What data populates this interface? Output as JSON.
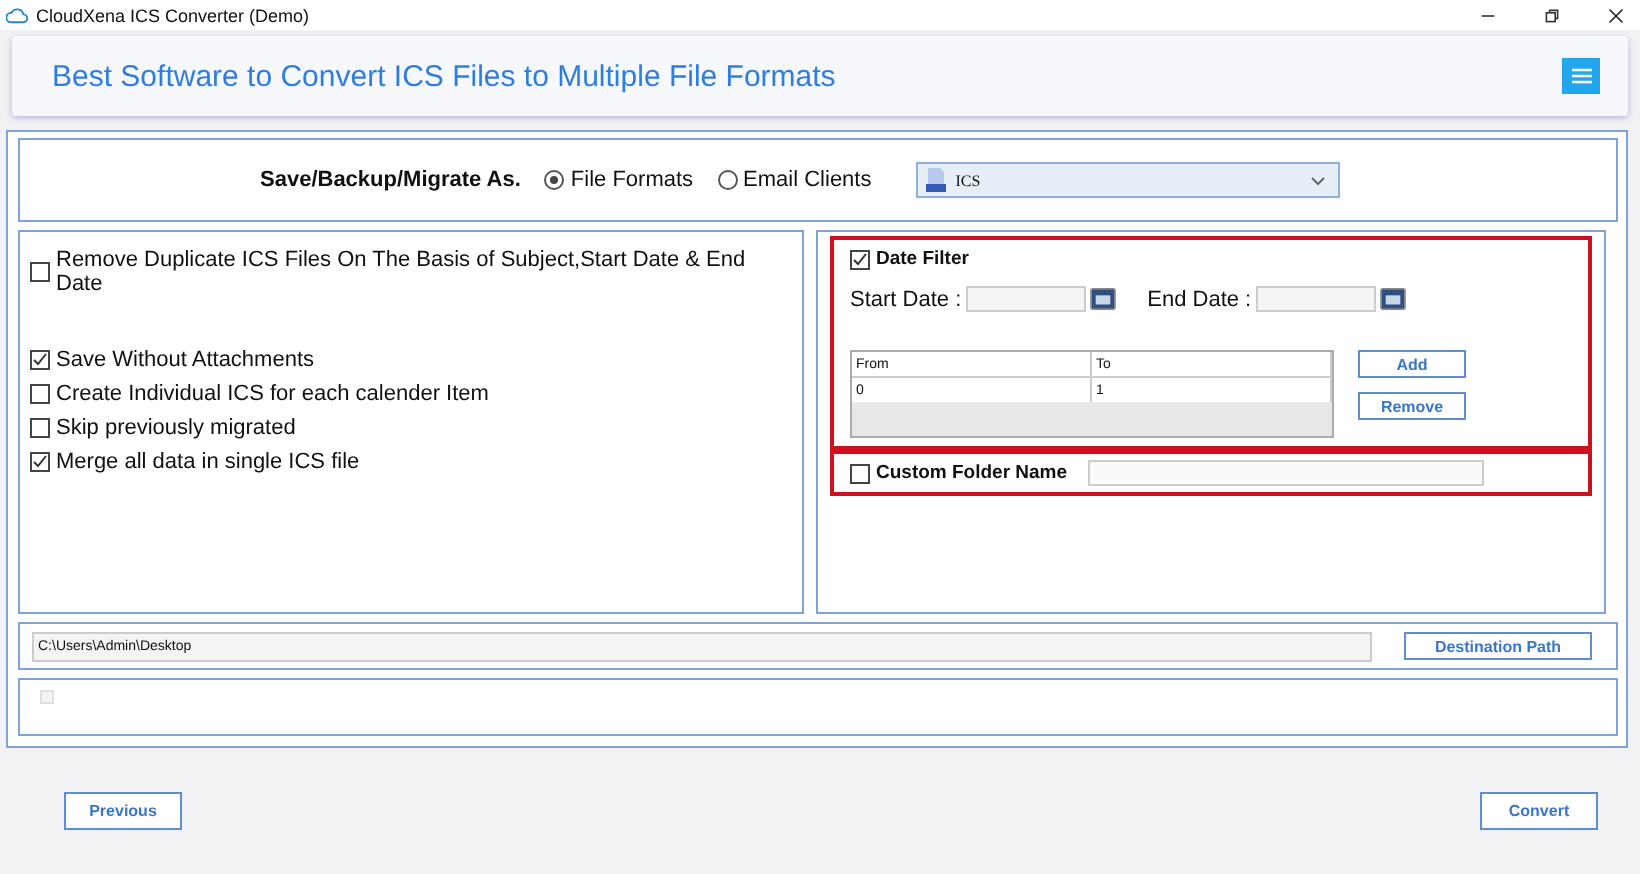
{
  "window": {
    "title": "CloudXena ICS Converter (Demo)"
  },
  "header": {
    "title": "Best Software to Convert ICS Files to Multiple File Formats"
  },
  "save_as": {
    "label": "Save/Backup/Migrate As.",
    "options": [
      {
        "label": "File Formats",
        "selected": true
      },
      {
        "label": "Email Clients",
        "selected": false
      }
    ],
    "format": "ICS"
  },
  "options": [
    {
      "label": "Remove Duplicate ICS Files On The Basis of Subject,Start Date & End Date",
      "checked": false
    },
    {
      "label": "Save Without Attachments",
      "checked": true
    },
    {
      "label": "Create Individual ICS for each calender Item",
      "checked": false
    },
    {
      "label": "Skip previously migrated",
      "checked": false
    },
    {
      "label": "Merge all data in single ICS file",
      "checked": true
    }
  ],
  "date_filter": {
    "label": "Date Filter",
    "checked": true,
    "start_label": "Start Date :",
    "end_label": "End Date :",
    "columns": [
      "From",
      "To"
    ],
    "rows": [
      [
        "0",
        "1"
      ]
    ],
    "buttons": [
      "Add",
      "Remove"
    ]
  },
  "custom_folder": {
    "label": "Custom Folder Name",
    "checked": false
  },
  "destination": {
    "path": "C:\\Users\\Admin\\Desktop",
    "button": "Destination Path"
  },
  "status_checkbox": {
    "checked": false,
    "disabled": true
  },
  "buttons": [
    "Previous",
    "Convert"
  ]
}
